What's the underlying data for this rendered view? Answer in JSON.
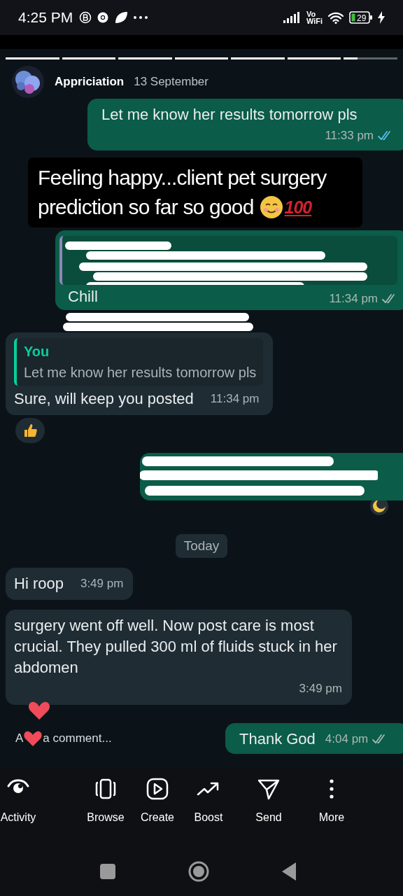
{
  "status_bar": {
    "time": "4:25 PM",
    "network_top": "Vo",
    "network_bottom": "WiFi",
    "battery": "29",
    "charging": true
  },
  "story": {
    "segments": [
      {
        "level": 1
      },
      {
        "level": 1
      },
      {
        "level": 1
      },
      {
        "level": 1
      },
      {
        "level": 1
      },
      {
        "level": 1
      },
      {
        "level": 0.25
      }
    ],
    "author": "Appriciation",
    "date": "13 September",
    "messages": [
      {
        "kind": "sent",
        "text": "Let me know her results tomorrow pls",
        "time": "11:33 pm",
        "read": true
      },
      {
        "kind": "caption",
        "lines": [
          "Feeling happy...client pet surgery",
          "prediction so far so good"
        ],
        "badge": "100"
      },
      {
        "kind": "redacted",
        "text": "Chill",
        "time": "11:34 pm",
        "read": false
      },
      {
        "kind": "received",
        "quote_author": "You",
        "quote_text": "Let me know her results tomorrow pls",
        "text": "Sure, will keep you posted",
        "time": "11:34 pm",
        "reaction": {
          "kind": "thumbs_up"
        }
      },
      {
        "kind": "redacted_full"
      },
      {
        "kind": "date",
        "text": "Today"
      },
      {
        "kind": "received",
        "text": "Hi roop",
        "time": "3:49 pm"
      },
      {
        "kind": "received",
        "text": "surgery went off well. Now post care is most crucial. They pulled 300 ml of fluids stuck in her abdomen",
        "time": "3:49 pm",
        "reaction": {
          "kind": "heart"
        }
      }
    ],
    "comment": {
      "placeholder_start": "A",
      "placeholder_end": "a comment..."
    },
    "last_message": {
      "text": "Thank God",
      "time": "4:04 pm",
      "read": false
    }
  },
  "actions": [
    {
      "label": "Activity"
    },
    {
      "label": "Browse"
    },
    {
      "label": "Create"
    },
    {
      "label": "Boost"
    },
    {
      "label": "Send"
    },
    {
      "label": "More"
    }
  ]
}
